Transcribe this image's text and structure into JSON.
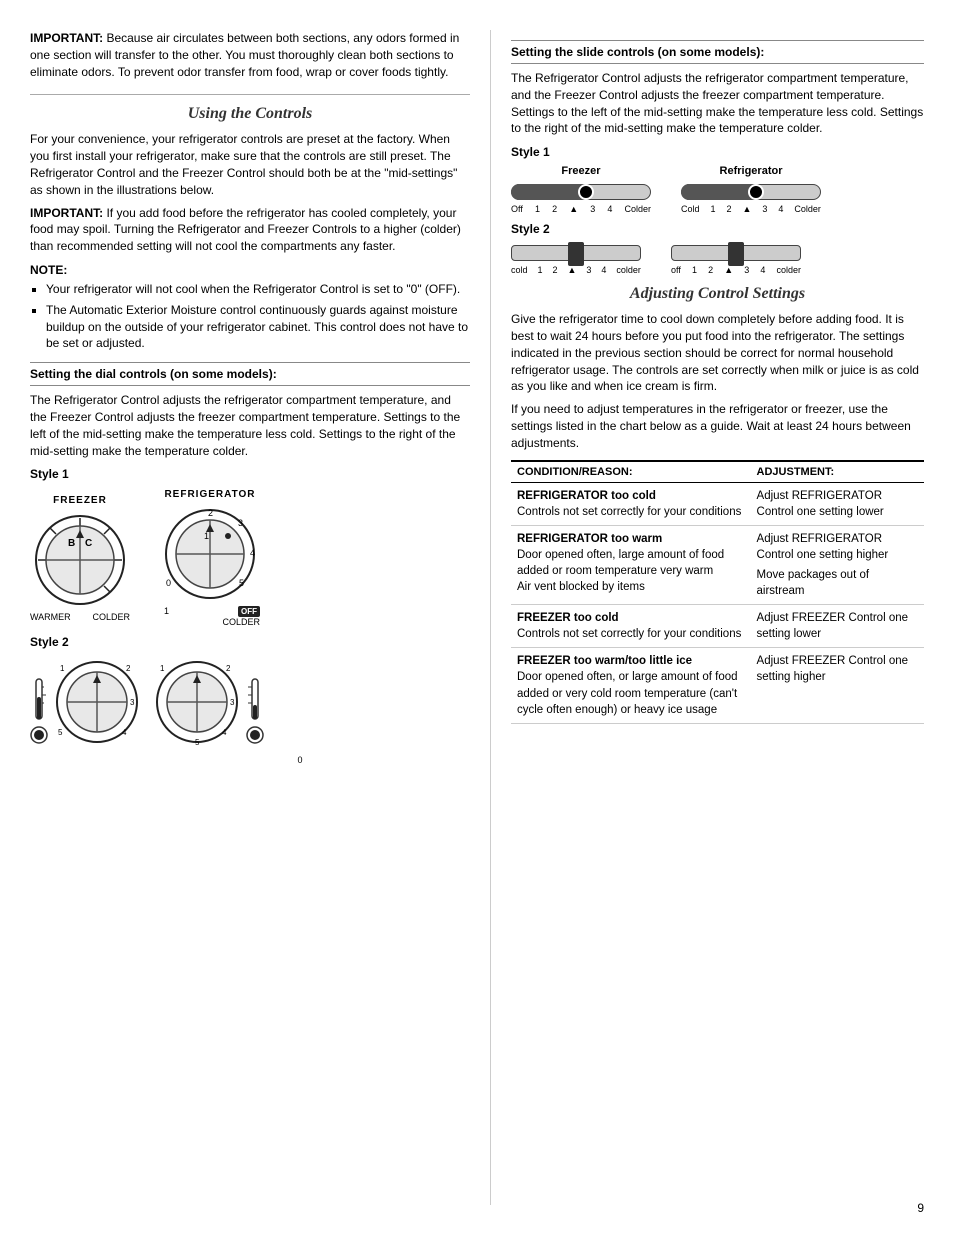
{
  "page": {
    "number": "9"
  },
  "left": {
    "top_paragraph": "Because air circulates between both sections, any odors formed in one section will transfer to the other. You must thoroughly clean both sections to eliminate odors. To prevent odor transfer from food, wrap or cover foods tightly.",
    "top_bold": "IMPORTANT:",
    "section_title": "Using the Controls",
    "intro_bold": "IMPORTANT:",
    "intro_p1": "For your convenience, your refrigerator controls are preset at the factory. When you first install your refrigerator, make sure that the controls are still preset. The Refrigerator Control and the Freezer Control should both be at the \"mid-settings\" as shown in the illustrations below.",
    "intro_p2": "If you add food before the refrigerator has cooled completely, your food may spoil. Turning the Refrigerator and Freezer Controls to a higher (colder) than recommended setting will not cool the compartments any faster.",
    "note_label": "NOTE:",
    "note_bullets": [
      "Your refrigerator will not cool when the Refrigerator Control is set to \"0\" (OFF).",
      "The Automatic Exterior Moisture control continuously guards against moisture buildup on the outside of your refrigerator cabinet. This control does not have to be set or adjusted."
    ],
    "subsection_dial": "Setting the dial controls (on some models):",
    "dial_description": "The Refrigerator Control adjusts the refrigerator compartment temperature, and the Freezer Control adjusts the freezer compartment temperature. Settings to the left of the mid-setting make the temperature less cold. Settings to the right of the mid-setting make the temperature colder.",
    "style1_label": "Style 1",
    "style2_label": "Style 2",
    "freezer_label": "FREEZER",
    "refrigerator_label": "REFRIGERATOR",
    "warmer_label": "WARMER",
    "colder_label": "COLDER",
    "dial1_ticks": [
      "B",
      "C"
    ],
    "dial2_nums": [
      "1",
      "2",
      "3",
      "4",
      "5",
      "0"
    ],
    "off_label": "OFF",
    "style2_dial_nums_left": [
      "1",
      "2",
      "3",
      "4",
      "5"
    ],
    "style2_dial_nums_right": [
      "1",
      "2",
      "3",
      "4",
      "5"
    ],
    "style2_zero": "0"
  },
  "right": {
    "subsection_slide": "Setting the slide controls (on some models):",
    "slide_description": "The Refrigerator Control adjusts the refrigerator compartment temperature, and the Freezer Control adjusts the freezer compartment temperature. Settings to the left of the mid-setting make the temperature less cold. Settings to the right of the mid-setting make the temperature colder.",
    "style1_label": "Style 1",
    "style2_label": "Style 2",
    "freezer_label": "Freezer",
    "refrigerator_label": "Refrigerator",
    "s1_freezer_off": "Off",
    "s1_freezer_nums": [
      "1",
      "2",
      "▲",
      "3",
      "4"
    ],
    "s1_freezer_colder": "Colder",
    "s1_refrig_cold": "Cold",
    "s1_refrig_nums": [
      "1",
      "2",
      "▲",
      "3",
      "4"
    ],
    "s1_refrig_colder": "Colder",
    "s2_freezer_cold": "cold",
    "s2_freezer_nums": [
      "1",
      "2",
      "▲",
      "3",
      "4"
    ],
    "s2_freezer_colder": "colder",
    "s2_refrig_off": "off",
    "s2_refrig_nums": [
      "1",
      "2",
      "▲",
      "3",
      "4"
    ],
    "s2_refrig_colder": "colder",
    "adj_section_title": "Adjusting Control Settings",
    "adj_description1": "Give the refrigerator time to cool down completely before adding food. It is best to wait 24 hours before you put food into the refrigerator. The settings indicated in the previous section should be correct for normal household refrigerator usage. The controls are set correctly when milk or juice is as cold as you like and when ice cream is firm.",
    "adj_description2": "If you need to adjust temperatures in the refrigerator or freezer, use the settings listed in the chart below as a guide. Wait at least 24 hours between adjustments.",
    "table": {
      "col1_header": "CONDITION/REASON:",
      "col2_header": "ADJUSTMENT:",
      "rows": [
        {
          "condition_bold": "REFRIGERATOR too cold",
          "condition_detail": "Controls not set correctly for your conditions",
          "adjustment": "Adjust REFRIGERATOR Control one setting lower"
        },
        {
          "condition_bold": "REFRIGERATOR too warm",
          "condition_detail": "Door opened often, large amount of food added or room temperature very warm\nAir vent blocked by items",
          "adjustment": "Adjust REFRIGERATOR Control one setting higher\nMove packages out of airstream"
        },
        {
          "condition_bold": "FREEZER too cold",
          "condition_detail": "Controls not set correctly for your conditions",
          "adjustment": "Adjust FREEZER Control one setting lower"
        },
        {
          "condition_bold": "FREEZER too warm/too little ice",
          "condition_detail": "Door opened often, or large amount of food added or very cold room temperature (can't cycle often enough) or heavy ice usage",
          "adjustment": "Adjust FREEZER Control one setting higher"
        }
      ]
    }
  }
}
